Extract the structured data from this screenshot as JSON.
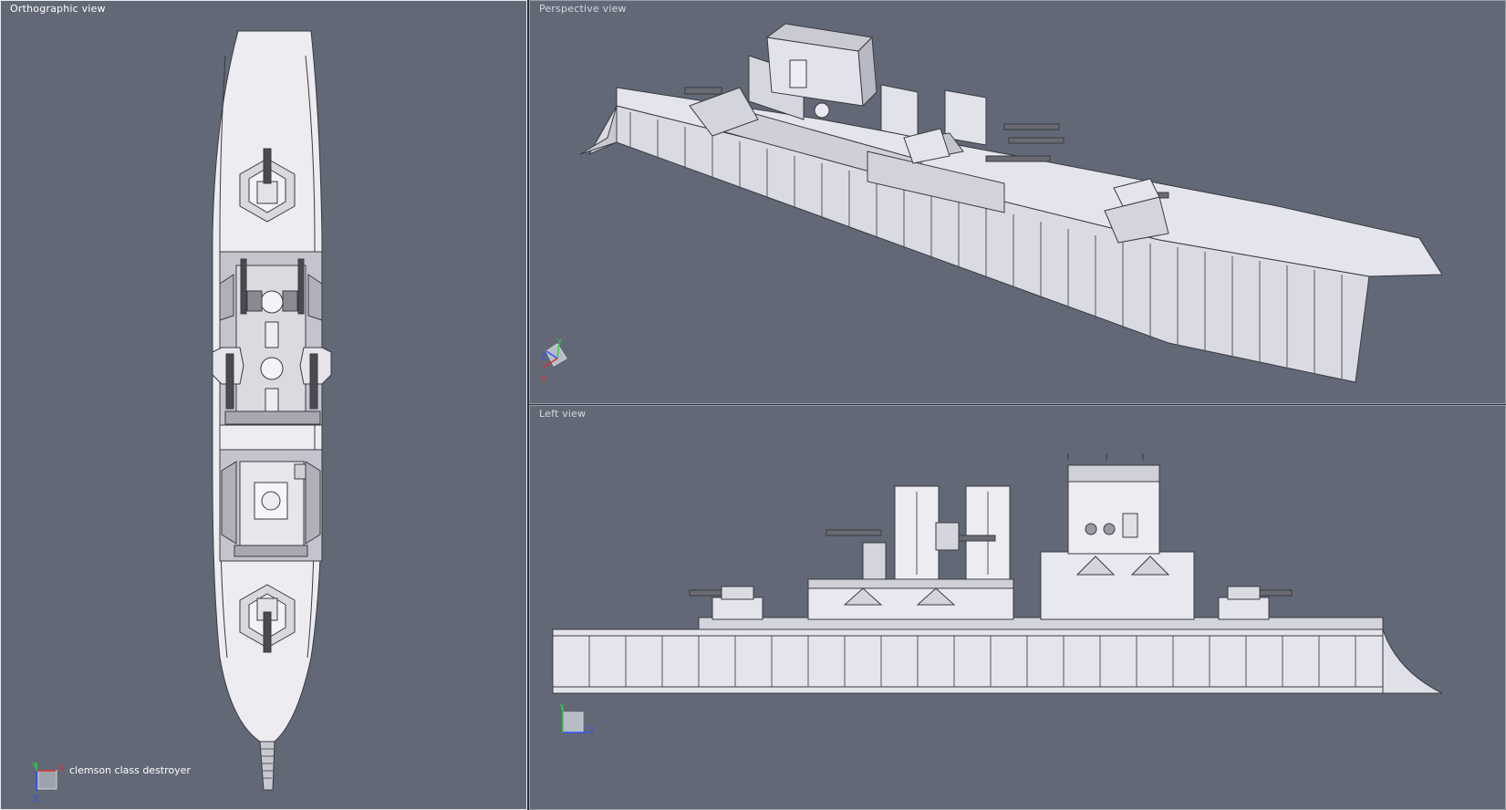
{
  "viewports": {
    "orthographic": {
      "label": "Orthographic view"
    },
    "perspective": {
      "label": "Perspective view"
    },
    "left": {
      "label": "Left view"
    }
  },
  "object": {
    "name": "clemson class destroyer"
  },
  "axes": {
    "ortho": {
      "x": "X",
      "y": "Y",
      "z": "Z"
    },
    "persp": {
      "x": "X",
      "y": "Y",
      "z": "Z"
    },
    "left": {
      "y": "Y",
      "z": "Z"
    }
  },
  "colors": {
    "viewport_bg": "#626876",
    "model_fill": "#e9e9ef",
    "model_line": "#3a3a40",
    "axis_x": "#e03030",
    "axis_y": "#30d040",
    "axis_z": "#3050ff"
  }
}
